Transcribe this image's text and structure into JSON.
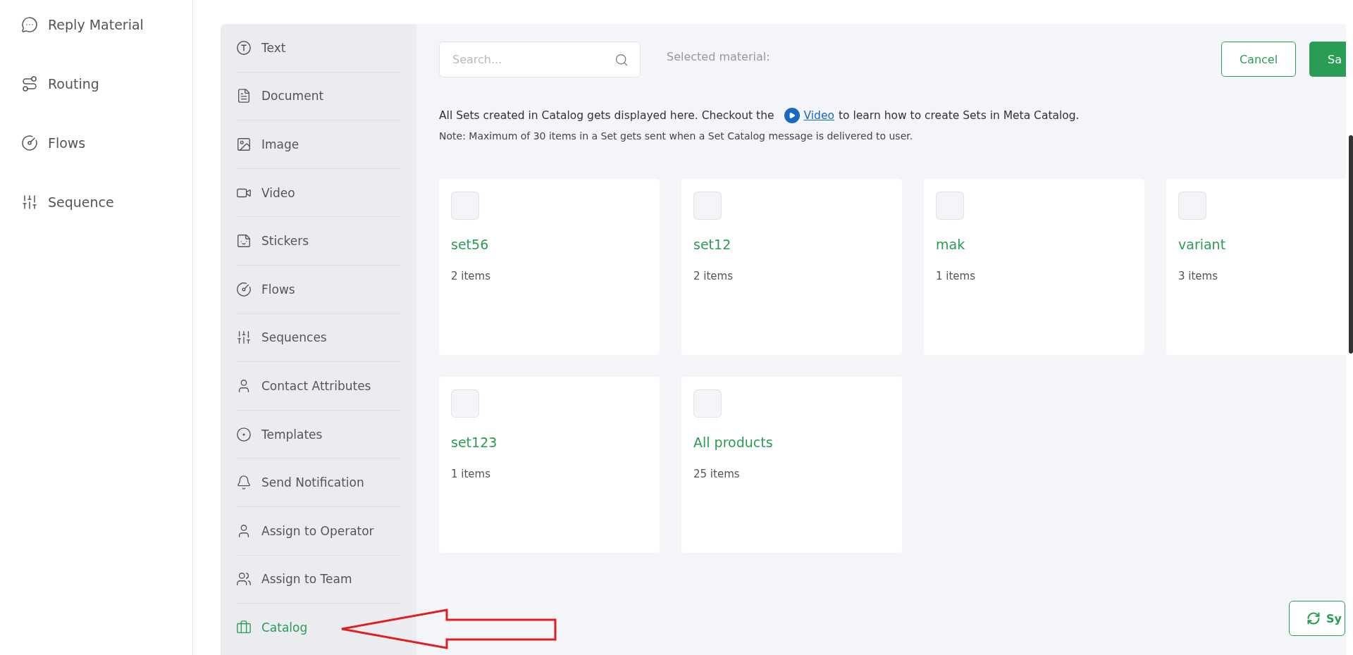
{
  "nav": {
    "items": [
      {
        "label": "Reply Material"
      },
      {
        "label": "Routing"
      },
      {
        "label": "Flows"
      },
      {
        "label": "Sequence"
      }
    ]
  },
  "material_menu": {
    "items": [
      {
        "label": "Text",
        "selected": false
      },
      {
        "label": "Document",
        "selected": false
      },
      {
        "label": "Image",
        "selected": false
      },
      {
        "label": "Video",
        "selected": false
      },
      {
        "label": "Stickers",
        "selected": false
      },
      {
        "label": "Flows",
        "selected": false
      },
      {
        "label": "Sequences",
        "selected": false
      },
      {
        "label": "Contact Attributes",
        "selected": false
      },
      {
        "label": "Templates",
        "selected": false
      },
      {
        "label": "Send Notification",
        "selected": false
      },
      {
        "label": "Assign to Operator",
        "selected": false
      },
      {
        "label": "Assign to Team",
        "selected": false
      },
      {
        "label": "Catalog",
        "selected": true
      }
    ]
  },
  "search": {
    "placeholder": "Search..."
  },
  "selected_material_label": "Selected material:",
  "buttons": {
    "cancel": "Cancel",
    "save": "Sa"
  },
  "info": {
    "before_link": "All Sets created in Catalog gets displayed here. Checkout the",
    "link": "Video",
    "after_link": "to learn how to create Sets in Meta Catalog.",
    "note": "Note: Maximum of 30 items in a Set gets sent when a Set Catalog message is delivered to user."
  },
  "sets": [
    {
      "name": "set56",
      "count": "2 items",
      "checked": false
    },
    {
      "name": "set12",
      "count": "2 items",
      "checked": false
    },
    {
      "name": "mak",
      "count": "1 items",
      "checked": false
    },
    {
      "name": "variant",
      "count": "3 items",
      "checked": false
    },
    {
      "name": "set123",
      "count": "1 items",
      "checked": false
    },
    {
      "name": "All products",
      "count": "25 items",
      "checked": false
    }
  ],
  "sync_button": {
    "label": "Sy"
  }
}
